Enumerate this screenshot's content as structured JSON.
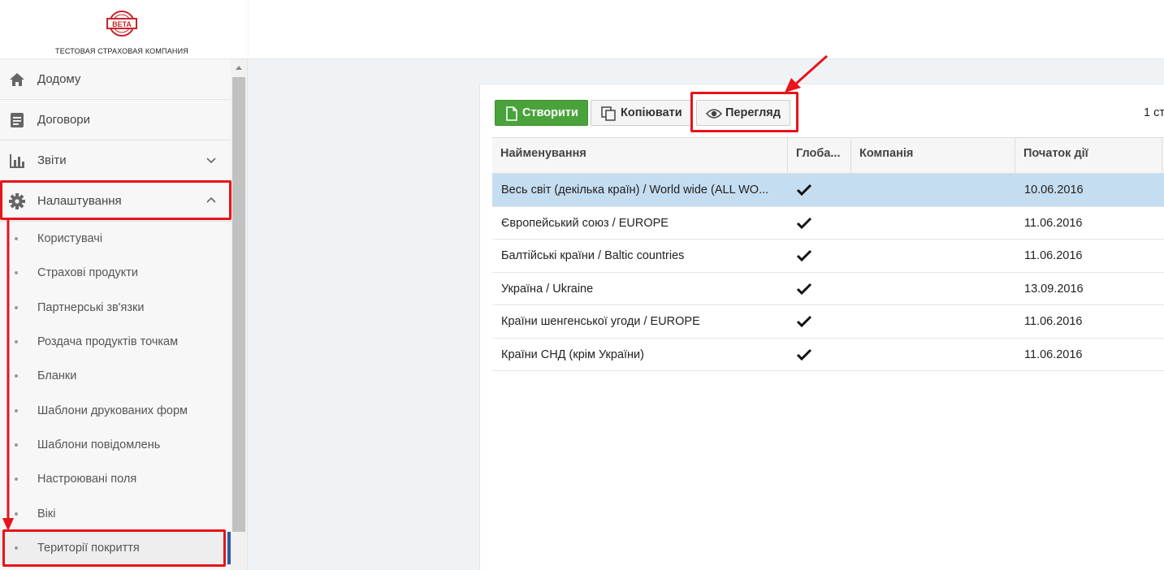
{
  "company": {
    "name": "ТЕСТОВАЯ СТРАХОВАЯ КОМПАНИЯ",
    "badge": "BETA"
  },
  "nav": {
    "home": "Додому",
    "contracts": "Договори",
    "reports": "Звіти",
    "settings": "Налаштування"
  },
  "settings_items": [
    {
      "label": "Користувачі"
    },
    {
      "label": "Страхові продукти"
    },
    {
      "label": "Партнерські зв'язки"
    },
    {
      "label": "Роздача продуктів точкам"
    },
    {
      "label": "Бланки"
    },
    {
      "label": "Шаблони друкованих форм"
    },
    {
      "label": "Шаблони повідомлень"
    },
    {
      "label": "Настроювані поля"
    },
    {
      "label": "Вікі"
    },
    {
      "label": "Території покриття"
    }
  ],
  "toolbar": {
    "create": "Створити",
    "copy": "Копіювати",
    "view": "Перегляд",
    "pager": "1 ст"
  },
  "table": {
    "columns": [
      "Найменування",
      "Глоба...",
      "Компанія",
      "Початок дії"
    ],
    "rows": [
      {
        "name": "Весь світ (декілька країн) / World wide (ALL WO...",
        "global": true,
        "company": "",
        "start": "10.06.2016"
      },
      {
        "name": "Європейський союз / EUROPE",
        "global": true,
        "company": "",
        "start": "11.06.2016"
      },
      {
        "name": "Балтійські країни / Baltic countries",
        "global": true,
        "company": "",
        "start": "11.06.2016"
      },
      {
        "name": "Україна / Ukraine",
        "global": true,
        "company": "",
        "start": "13.09.2016"
      },
      {
        "name": "Країни шенгенської угоди / EUROPE",
        "global": true,
        "company": "",
        "start": "11.06.2016"
      },
      {
        "name": "Країни СНД (крім України)",
        "global": true,
        "company": "",
        "start": "11.06.2016"
      }
    ]
  },
  "colors": {
    "accent_green": "#4aa33a",
    "selected_row": "#c4ddf1",
    "annotation_red": "#e8131b"
  }
}
